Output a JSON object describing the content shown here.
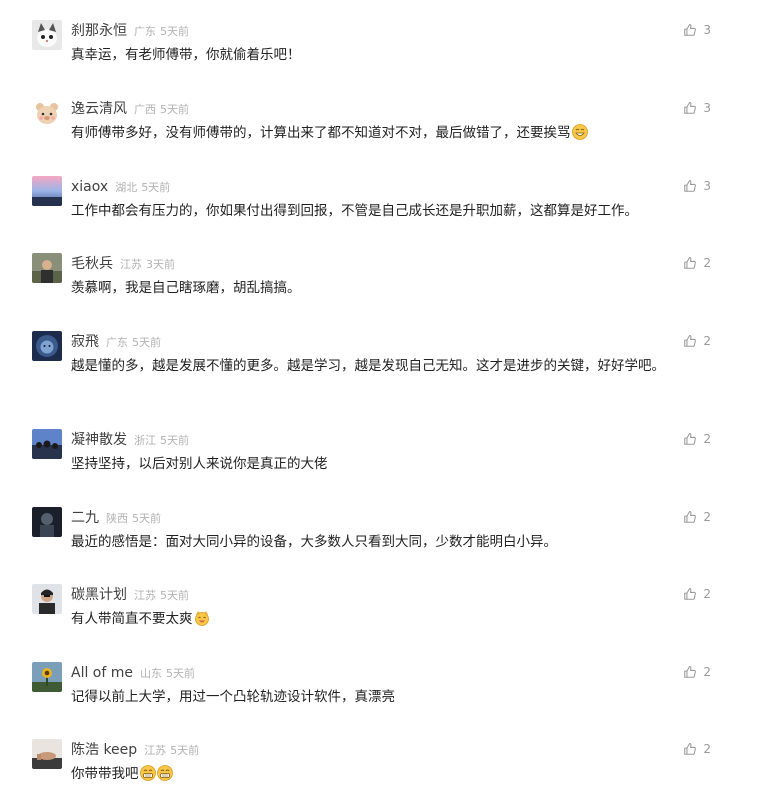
{
  "comments": [
    {
      "user": "刹那永恒",
      "location": "广东",
      "time": "5天前",
      "content": "真幸运，有老师傅带，你就偷着乐吧！",
      "likes": "3",
      "avatar": "cat-avatar",
      "emoji": []
    },
    {
      "user": "逸云清风",
      "location": "广西",
      "time": "5天前",
      "content": "有师傅带多好，没有师傅带的，计算出来了都不知道对不对，最后做错了，还要挨骂",
      "likes": "3",
      "avatar": "bear-avatar",
      "emoji": [
        "smile-emoji"
      ]
    },
    {
      "user": "xiaox",
      "location": "湖北",
      "time": "5天前",
      "content": "工作中都会有压力的，你如果付出得到回报，不管是自己成长还是升职加薪，这都算是好工作。",
      "likes": "3",
      "avatar": "sky-avatar",
      "emoji": []
    },
    {
      "user": "毛秋兵",
      "location": "江苏",
      "time": "3天前",
      "content": "羡慕啊，我是自己瞎琢磨，胡乱搞搞。",
      "likes": "2",
      "avatar": "person-avatar",
      "emoji": []
    },
    {
      "user": "寂飛",
      "location": "广东",
      "time": "5天前",
      "content": "越是懂的多，越是发展不懂的更多。越是学习，越是发现自己无知。这才是进步的关键，好好学吧。",
      "likes": "2",
      "avatar": "lion-avatar",
      "emoji": []
    },
    {
      "user": "凝神散发",
      "location": "浙江",
      "time": "5天前",
      "content": "坚持坚持，以后对别人来说你是真正的大佬",
      "likes": "2",
      "avatar": "crowd-avatar",
      "emoji": []
    },
    {
      "user": "二九",
      "location": "陕西",
      "time": "5天前",
      "content": "最近的感悟是：面对大同小异的设备，大多数人只看到大同，少数才能明白小异。",
      "likes": "2",
      "avatar": "dark-avatar",
      "emoji": []
    },
    {
      "user": "碳黑计划",
      "location": "江苏",
      "time": "5天前",
      "content": "有人带简直不要太爽",
      "likes": "2",
      "avatar": "man-avatar",
      "emoji": [
        "cat-laugh-emoji"
      ]
    },
    {
      "user": "All of me",
      "location": "山东",
      "time": "5天前",
      "content": "记得以前上大学，用过一个凸轮轨迹设计软件，真漂亮",
      "likes": "2",
      "avatar": "sunflower-avatar",
      "emoji": []
    },
    {
      "user": "陈浩 keep",
      "location": "江苏",
      "time": "5天前",
      "content": "你带带我吧",
      "likes": "2",
      "avatar": "hand-avatar",
      "emoji": [
        "grin-emoji",
        "grin-emoji"
      ]
    }
  ],
  "colors": {
    "name": "#404040",
    "meta": "#b2b2b2",
    "text": "#222222",
    "like": "#9a9a9a"
  }
}
